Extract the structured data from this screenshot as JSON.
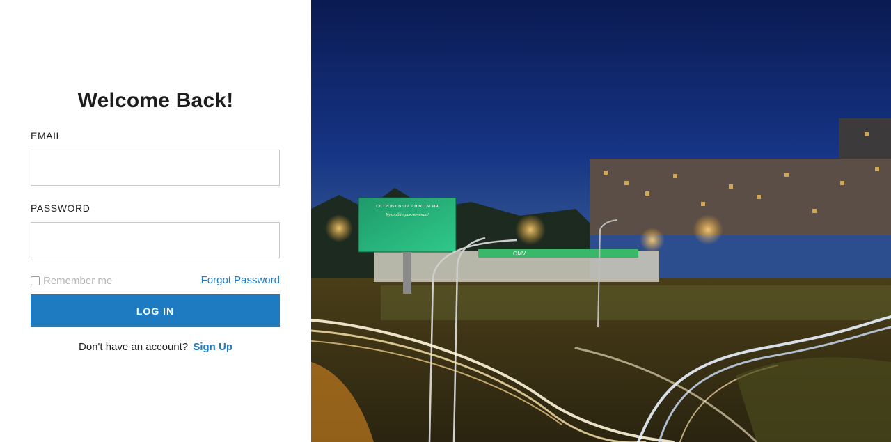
{
  "login": {
    "title": "Welcome Back!",
    "email_label": "EMAIL",
    "email_value": "",
    "password_label": "PASSWORD",
    "password_value": "",
    "remember_label": "Remember me",
    "remember_checked": false,
    "forgot_label": "Forgot Password",
    "login_button_label": "LOG IN",
    "signup_prompt": "Don't have an account?",
    "signup_link": "Sign Up",
    "accent_color": "#1f7bc1"
  },
  "hero": {
    "billboard_line1": "ОСТРОВ СВЕТА АНАСТАСИЯ",
    "billboard_line2": "Куклибй приключение!",
    "station_sign": "OMV",
    "description_colors": {
      "sky": "#0b1c55",
      "billboard": "#2bbd7e"
    }
  }
}
